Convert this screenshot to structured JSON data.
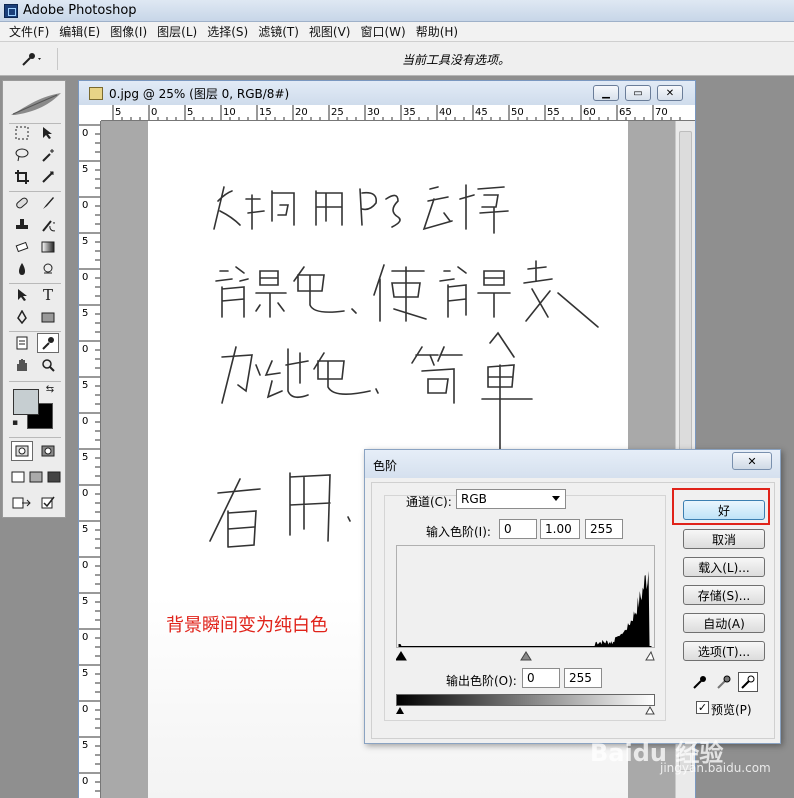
{
  "app": {
    "title": "Adobe Photoshop"
  },
  "menu": [
    "文件(F)",
    "编辑(E)",
    "图像(I)",
    "图层(L)",
    "选择(S)",
    "滤镜(T)",
    "视图(V)",
    "窗口(W)",
    "帮助(H)"
  ],
  "options_bar": {
    "hint": "当前工具没有选项。"
  },
  "document": {
    "title": "0.jpg @ 25% (图层 0, RGB/8#)",
    "hruler_ticks": [
      "5",
      "0",
      "5",
      "10",
      "15",
      "20",
      "25",
      "30",
      "35",
      "40",
      "45",
      "50",
      "55",
      "60",
      "65",
      "70"
    ],
    "vruler_ticks": [
      "0",
      "5",
      "0",
      "5",
      "0",
      "5",
      "0",
      "5",
      "0",
      "5",
      "0",
      "5",
      "0",
      "5",
      "0",
      "5",
      "0",
      "5",
      "0"
    ],
    "handwriting": [
      "如何用PS去掉",
      "背景色，使背景变",
      "为纯色，简单",
      "有用"
    ]
  },
  "caption": "背景瞬间变为纯白色",
  "levels_dialog": {
    "title": "色阶",
    "channel_label": "通道(C):",
    "channel_value": "RGB",
    "input_label": "输入色阶(I):",
    "input_black": "0",
    "input_gamma": "1.00",
    "input_white": "255",
    "output_label": "输出色阶(O):",
    "output_black": "0",
    "output_white": "255",
    "buttons": {
      "ok": "好",
      "cancel": "取消",
      "load": "载入(L)...",
      "save": "存储(S)...",
      "auto": "自动(A)",
      "options": "选项(T)..."
    },
    "preview_label": "预览(P)",
    "preview_checked": true
  },
  "watermark": {
    "brand": "Baidu 经验",
    "url": "jingyan.baidu.com"
  },
  "colors": {
    "highlight": "#e0231a",
    "foreground": "#c6ced1",
    "background": "#000000"
  },
  "icons": [
    "eyedropper-icon",
    "marquee-icon",
    "move-icon",
    "lasso-icon",
    "magic-wand-icon",
    "crop-icon",
    "slice-icon",
    "healing-icon",
    "brush-icon",
    "stamp-icon",
    "history-brush-icon",
    "eraser-icon",
    "gradient-icon",
    "blur-icon",
    "dodge-icon",
    "path-select-icon",
    "type-icon",
    "pen-icon",
    "shape-icon",
    "notes-icon",
    "eyedropper-tool-icon",
    "hand-icon",
    "zoom-icon"
  ]
}
